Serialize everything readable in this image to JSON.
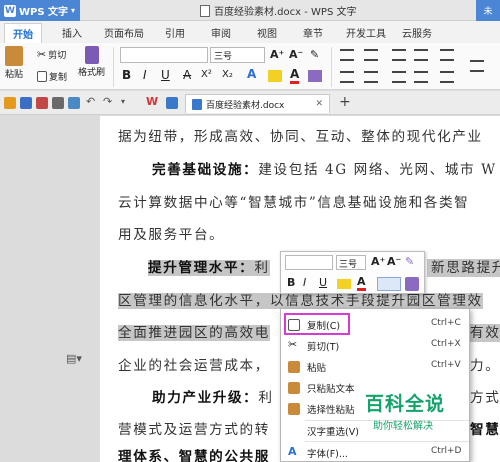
{
  "titlebar": {
    "app_name": "WPS 文字",
    "doc_title": "百度经验素材.docx - WPS 文字",
    "right_text": "未"
  },
  "ribbon_tabs": [
    "开始",
    "插入",
    "页面布局",
    "引用",
    "审阅",
    "视图",
    "章节",
    "开发工具",
    "云服务"
  ],
  "ribbon": {
    "paste_label": "粘贴",
    "cut_label": "剪切",
    "copy_label": "复制",
    "format_painter_label": "格式刷",
    "font_size": "三号",
    "bold": "B",
    "italic": "I",
    "underline": "U",
    "strike": "A",
    "superscript": "X²",
    "subscript": "X₂",
    "font_color_letter": "A"
  },
  "quick_access": {
    "doc_tab_label": "百度经验素材.docx",
    "new_tab": "+"
  },
  "document": {
    "lines": [
      "据为纽带，形成高效、协同、互动、整体的现代化产业",
      "云计算数据中心等“智慧城市”信息基础设施和各类智",
      "用及服务平台。",
      "区管理的信息化水平，以信息技术手段提升园区管理效",
      "全面推进园区的高效电",
      "企业的社会运营成本，",
      "营模式及运营方式的转",
      "理体系、智慧的公共服"
    ],
    "headings": {
      "h1_bold": "完善基础设施：",
      "h1_rest": "建设包括 4G 网络、光网、城市 W",
      "h2_bold": "提升管理水平：",
      "h2_mid": "利",
      "h2_tail": "新思路提升",
      "h3_bold": "助力产业升级：",
      "h3_mid": "利",
      "h3_tail": "方式"
    },
    "right_fragments": {
      "r1": "有效",
      "r2": "力。",
      "r3": "智慧"
    }
  },
  "mini_toolbar": {
    "font_size": "三号",
    "grow": "A⁺",
    "shrink": "A⁻",
    "bold": "B",
    "italic": "I",
    "underline": "U"
  },
  "context_menu": [
    {
      "label": "复制(C)",
      "shortcut": "Ctrl+C"
    },
    {
      "label": "剪切(T)",
      "shortcut": "Ctrl+X"
    },
    {
      "label": "粘贴",
      "shortcut": "Ctrl+V"
    },
    {
      "label": "只粘贴文本",
      "shortcut": ""
    },
    {
      "label": "选择性粘贴",
      "shortcut": ""
    },
    {
      "label": "汉字重选(V)",
      "shortcut": ""
    },
    {
      "label": "字体(F)...",
      "shortcut": "Ctrl+D"
    }
  ],
  "watermark": {
    "title": "百科全说",
    "subtitle": "助你轻松解决"
  },
  "colors": {
    "app_blue": "#4a86d4",
    "accent_tab": "#1f6fcf",
    "highlight_box": "#d63bd6",
    "watermark_green": "#14a36a",
    "selection_gray": "#c6c6c6"
  }
}
